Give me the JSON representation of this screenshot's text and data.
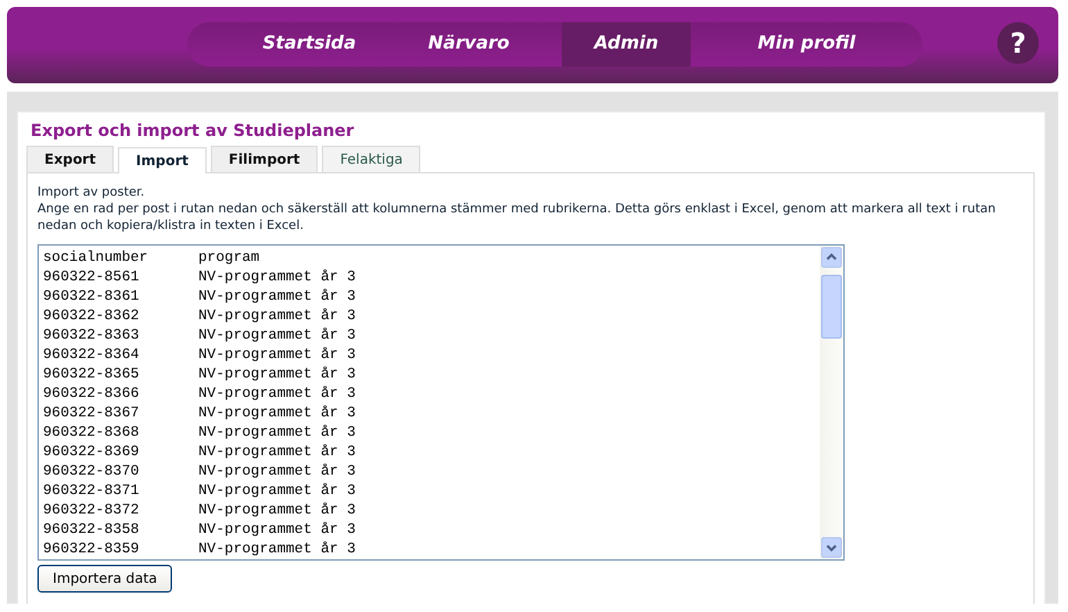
{
  "nav": {
    "items": [
      {
        "label": "Startsida",
        "selected": false
      },
      {
        "label": "Närvaro",
        "selected": false
      },
      {
        "label": "Admin",
        "selected": true
      },
      {
        "label": "Min profil",
        "selected": false
      }
    ],
    "help": "?"
  },
  "page": {
    "title": "Export och import av Studieplaner",
    "tabs": [
      {
        "label": "Export",
        "selected": false,
        "kind": "normal"
      },
      {
        "label": "Import",
        "selected": true,
        "kind": "normal"
      },
      {
        "label": "Filimport",
        "selected": false,
        "kind": "normal"
      },
      {
        "label": "Felaktiga",
        "selected": false,
        "kind": "muted"
      }
    ],
    "intro": "Import av poster.",
    "instructions": "Ange en rad per post i rutan nedan och säkerställ att kolumnerna stämmer med rubrikerna. Detta görs enklast i Excel, genom att markera all text i rutan nedan och kopiera/klistra in texten i Excel.",
    "import_text": {
      "header": [
        "socialnumber",
        "program"
      ],
      "rows": [
        [
          "960322-8561",
          "NV-programmet år 3"
        ],
        [
          "960322-8361",
          "NV-programmet år 3"
        ],
        [
          "960322-8362",
          "NV-programmet år 3"
        ],
        [
          "960322-8363",
          "NV-programmet år 3"
        ],
        [
          "960322-8364",
          "NV-programmet år 3"
        ],
        [
          "960322-8365",
          "NV-programmet år 3"
        ],
        [
          "960322-8366",
          "NV-programmet år 3"
        ],
        [
          "960322-8367",
          "NV-programmet år 3"
        ],
        [
          "960322-8368",
          "NV-programmet år 3"
        ],
        [
          "960322-8369",
          "NV-programmet år 3"
        ],
        [
          "960322-8370",
          "NV-programmet år 3"
        ],
        [
          "960322-8371",
          "NV-programmet år 3"
        ],
        [
          "960322-8372",
          "NV-programmet år 3"
        ],
        [
          "960322-8358",
          "NV-programmet år 3"
        ],
        [
          "960322-8359",
          "NV-programmet år 3"
        ]
      ]
    },
    "button": "Importera data"
  }
}
